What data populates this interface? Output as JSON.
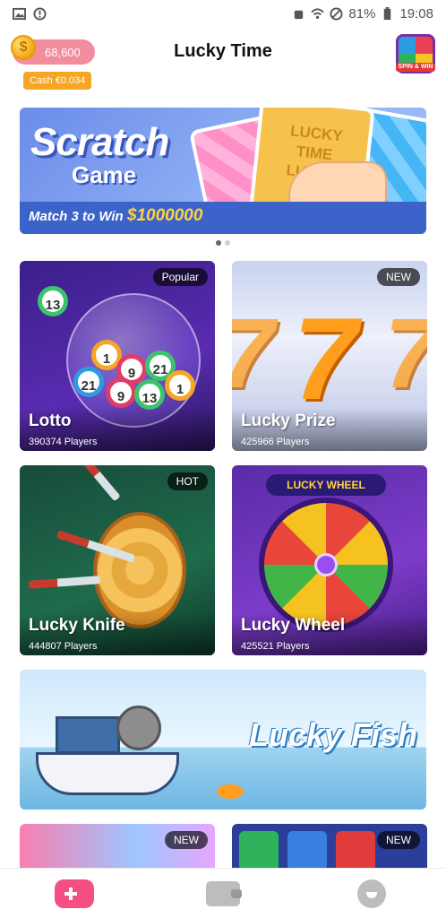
{
  "status_bar": {
    "battery": "81%",
    "time": "19:08"
  },
  "header": {
    "title": "Lucky Time",
    "coins": "68,600",
    "cash": "Cash €0.034",
    "coin_glyph": "$",
    "spin_win_label": "SPIN & WIN"
  },
  "banner": {
    "title": "Scratch",
    "subtitle": "Game",
    "match_text": "Match 3 to Win",
    "prize": "$1000000",
    "card_text": "LUCKY TIME\nLUCKY TIME\nLUCKY TIME",
    "page_count": 2,
    "active_page": 1
  },
  "games": [
    {
      "name": "Lotto",
      "players": "390374 Players",
      "tag": "Popular"
    },
    {
      "name": "Lucky Prize",
      "players": "425966 Players",
      "tag": "NEW"
    },
    {
      "name": "Lucky Knife",
      "players": "444807 Players",
      "tag": "HOT"
    },
    {
      "name": "Lucky Wheel",
      "players": "425521 Players",
      "tag": ""
    }
  ],
  "lotto_balls": [
    "13",
    "1",
    "9",
    "21",
    "21",
    "9",
    "13",
    "1"
  ],
  "wheel": {
    "banner": "LUCKY WHEEL"
  },
  "featured": {
    "title": "Lucky Fish"
  },
  "more_games": [
    {
      "tag": "NEW"
    },
    {
      "tag": "NEW"
    }
  ],
  "bottom_nav": {
    "items": [
      "games-icon",
      "wallet-icon",
      "profile-icon"
    ],
    "active_color": "#f34f83",
    "inactive_color": "#bdbdbd"
  }
}
